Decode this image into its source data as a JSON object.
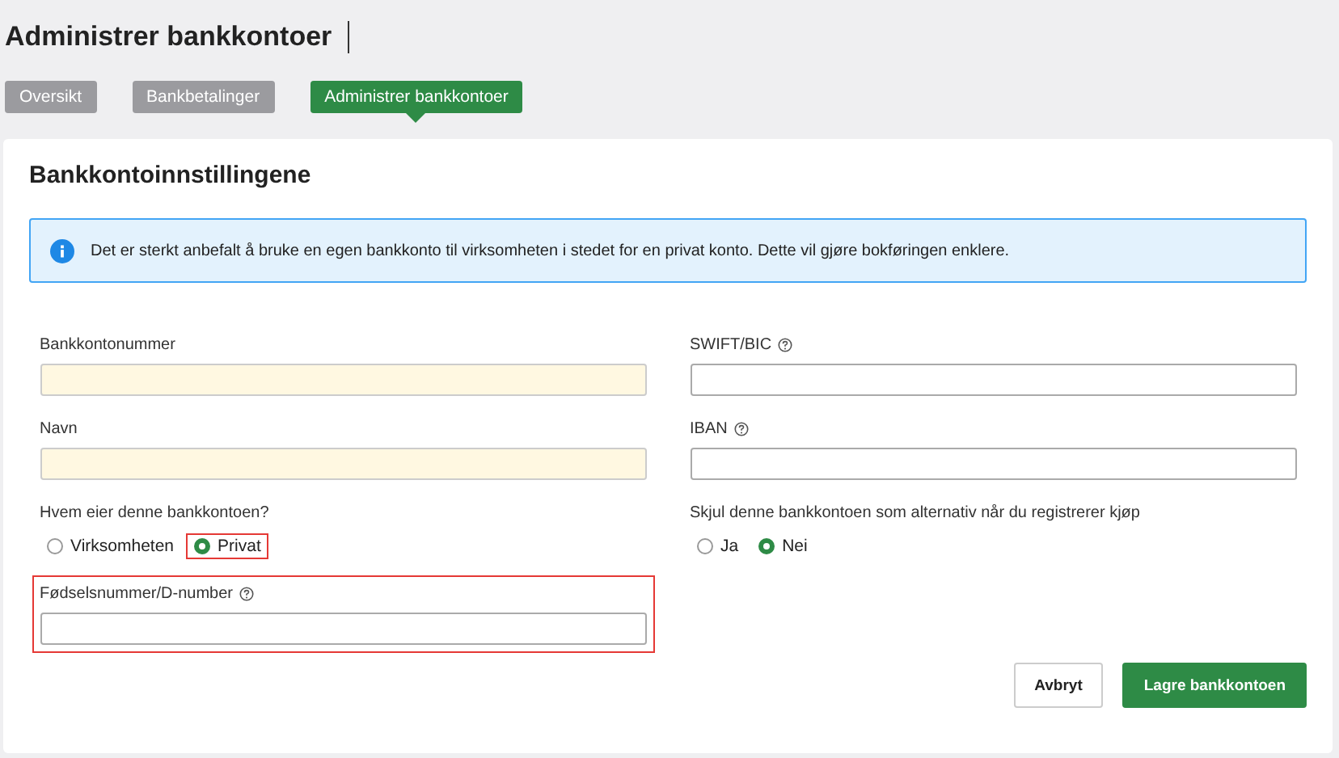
{
  "page_title": "Administrer bankkontoer",
  "tabs": [
    {
      "label": "Oversikt",
      "selected": false
    },
    {
      "label": "Bankbetalinger",
      "selected": false
    },
    {
      "label": "Administrer bankkontoer",
      "selected": true
    }
  ],
  "card": {
    "title": "Bankkontoinnstillingene",
    "info": "Det er sterkt anbefalt å bruke en egen bankkonto til virksomheten i stedet for en privat konto. Dette vil gjøre bokføringen enklere.",
    "rows": [
      [
        {
          "kind": "input",
          "label": "Bankkontonummer",
          "help": false,
          "required": true,
          "highlighted": false
        },
        {
          "kind": "input",
          "label": "SWIFT/BIC",
          "help": true,
          "required": false,
          "highlighted": false
        }
      ],
      [
        {
          "kind": "input",
          "label": "Navn",
          "help": false,
          "required": true,
          "highlighted": false
        },
        {
          "kind": "input",
          "label": "IBAN",
          "help": true,
          "required": false,
          "highlighted": false
        }
      ],
      [
        {
          "kind": "radio",
          "label": "Hvem eier denne bankkontoen?",
          "options": [
            {
              "label": "Virksomheten",
              "selected": false,
              "highlighted": false
            },
            {
              "label": "Privat",
              "selected": true,
              "highlighted": true
            }
          ]
        },
        {
          "kind": "radio",
          "label": "Skjul denne bankkontoen som alternativ når du registrerer kjøp",
          "options": [
            {
              "label": "Ja",
              "selected": false,
              "highlighted": false
            },
            {
              "label": "Nei",
              "selected": true,
              "highlighted": false
            }
          ]
        }
      ],
      [
        {
          "kind": "input",
          "label": "Fødselsnummer/D-number",
          "help": true,
          "required": false,
          "highlighted": true
        }
      ]
    ],
    "buttons": [
      {
        "label": "Avbryt",
        "kind": "secondary"
      },
      {
        "label": "Lagre bankkontoen",
        "kind": "primary"
      }
    ]
  }
}
